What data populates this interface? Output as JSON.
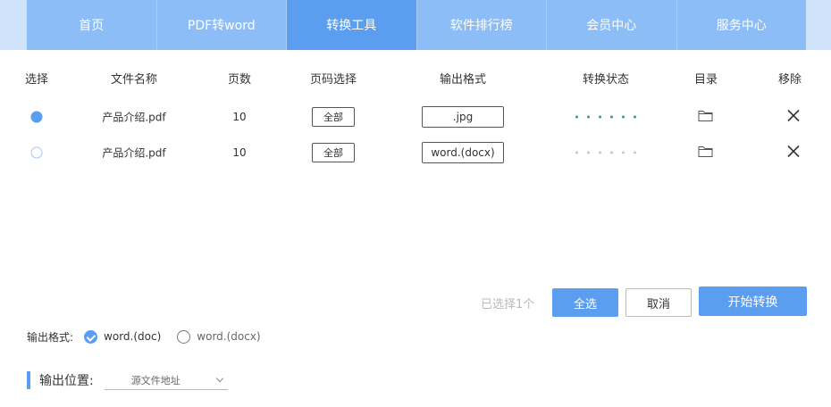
{
  "nav": {
    "items": [
      "首页",
      "PDF转word",
      "转换工具",
      "软件排行榜",
      "会员中心",
      "服务中心"
    ],
    "active_index": 2
  },
  "table": {
    "headers": {
      "select": "选择",
      "filename": "文件名称",
      "pages": "页数",
      "page_select": "页码选择",
      "output_format": "输出格式",
      "status": "转换状态",
      "folder": "目录",
      "remove": "移除"
    },
    "rows": [
      {
        "selected": true,
        "filename": "产品介绍.pdf",
        "pages": "10",
        "page_select": "全部",
        "format": ".jpg",
        "status": "done",
        "folder_icon": "folder-icon",
        "remove_icon": "close-icon"
      },
      {
        "selected": false,
        "filename": "产品介绍.pdf",
        "pages": "10",
        "page_select": "全部",
        "format": "word.(docx)",
        "status": "pending",
        "folder_icon": "folder-icon",
        "remove_icon": "close-icon"
      }
    ]
  },
  "actions": {
    "selected_count": "已选择1个",
    "select_all": "全选",
    "cancel": "取消",
    "start": "开始转换"
  },
  "output_format": {
    "label": "输出格式:",
    "options": [
      {
        "label": "word.(doc)",
        "checked": true
      },
      {
        "label": "word.(docx)",
        "checked": false
      }
    ]
  },
  "output_location": {
    "label": "输出位置:",
    "value": "源文件地址"
  },
  "colors": {
    "accent": "#5b9def",
    "nav_item": "#8dbdf6",
    "nav_bg": "#cfe3fb",
    "status_done": "#2aa37a",
    "status_pending": "#c9c9c9"
  }
}
